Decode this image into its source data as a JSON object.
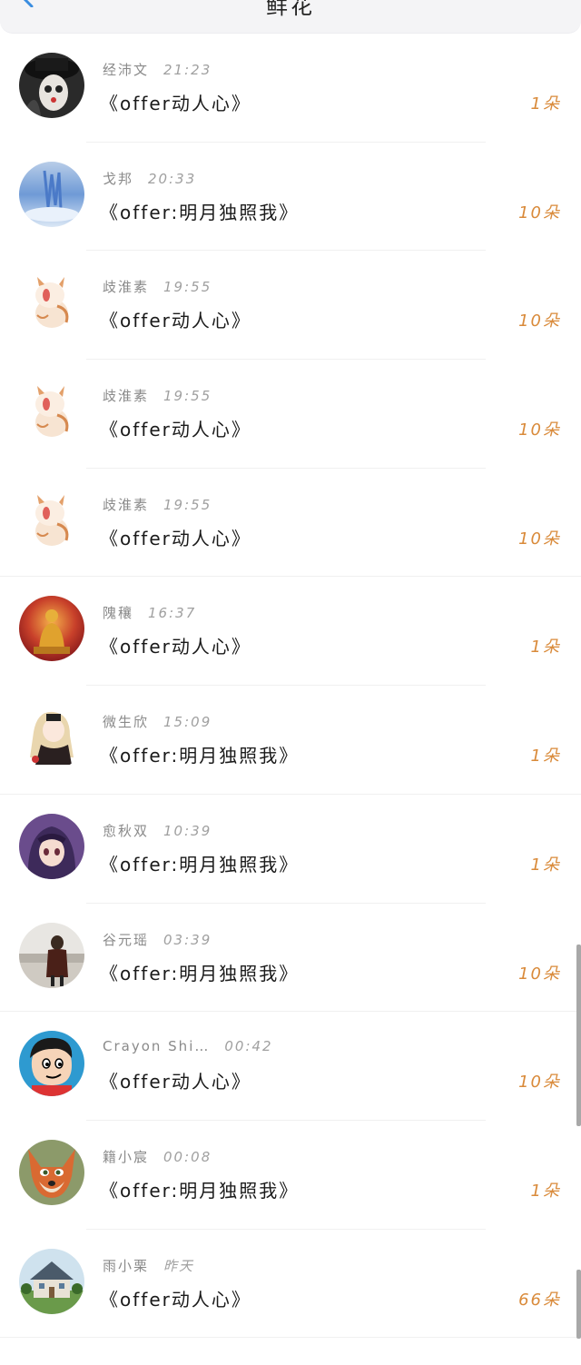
{
  "header": {
    "title": "鲜花"
  },
  "entries": [
    {
      "name": "经沛文",
      "time": "21:23",
      "gift": "《offer动人心》",
      "count": "1朵",
      "avatar": "gothic-girl-avatar"
    },
    {
      "name": "戈邦",
      "time": "20:33",
      "gift": "《offer:明月独照我》",
      "count": "10朵",
      "avatar": "blue-crystal-avatar"
    },
    {
      "name": "歧淮素",
      "time": "19:55",
      "gift": "《offer动人心》",
      "count": "10朵",
      "avatar": "cat-avatar"
    },
    {
      "name": "歧淮素",
      "time": "19:55",
      "gift": "《offer动人心》",
      "count": "10朵",
      "avatar": "cat-avatar"
    },
    {
      "name": "歧淮素",
      "time": "19:55",
      "gift": "《offer动人心》",
      "count": "10朵",
      "avatar": "cat-avatar"
    },
    {
      "name": "隗穰",
      "time": "16:37",
      "gift": "《offer动人心》",
      "count": "1朵",
      "avatar": "buddha-avatar"
    },
    {
      "name": "微生欣",
      "time": "15:09",
      "gift": "《offer:明月独照我》",
      "count": "1朵",
      "avatar": "anime-girl-avatar"
    },
    {
      "name": "愈秋双",
      "time": "10:39",
      "gift": "《offer:明月独照我》",
      "count": "1朵",
      "avatar": "purple-girl-avatar"
    },
    {
      "name": "谷元瑶",
      "time": "03:39",
      "gift": "《offer:明月独照我》",
      "count": "10朵",
      "avatar": "street-photo-avatar"
    },
    {
      "name": "Crayon Shi…",
      "time": "00:42",
      "gift": "《offer动人心》",
      "count": "10朵",
      "avatar": "crayon-shin-avatar"
    },
    {
      "name": "籍小宸",
      "time": "00:08",
      "gift": "《offer:明月独照我》",
      "count": "1朵",
      "avatar": "fox-avatar"
    },
    {
      "name": "雨小栗",
      "time": "昨天",
      "gift": "《offer动人心》",
      "count": "66朵",
      "avatar": "house-avatar"
    }
  ],
  "colors": {
    "accent": "#d98a3a",
    "back": "#3a8de0",
    "text": "#1a1a1a",
    "muted": "#8a8a8a"
  }
}
